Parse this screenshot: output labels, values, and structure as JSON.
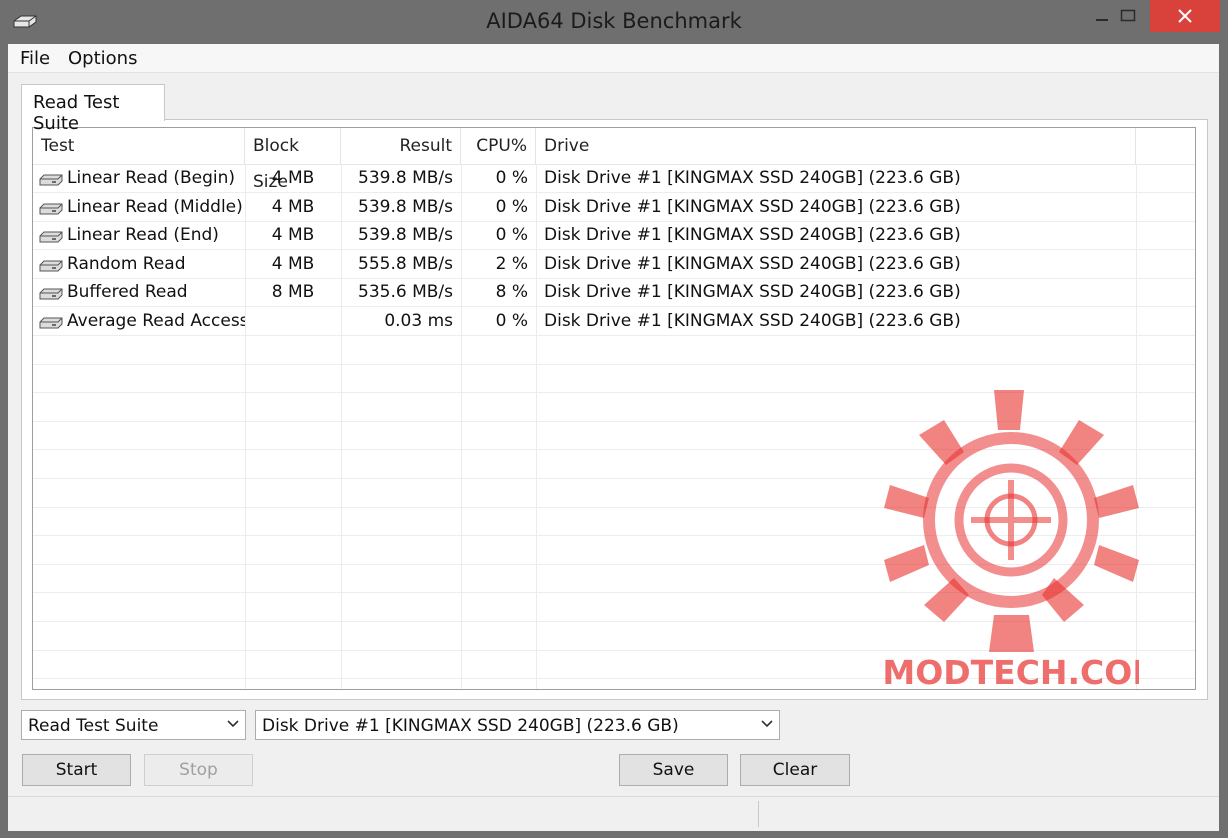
{
  "window": {
    "title": "AIDA64 Disk Benchmark",
    "close_color": "#d9413b"
  },
  "menu": [
    "File",
    "Options"
  ],
  "tab": {
    "label": "Read Test Suite"
  },
  "table": {
    "columns": [
      "Test",
      "Block Size",
      "Result",
      "CPU%",
      "Drive"
    ],
    "rows": [
      {
        "test": "Linear Read (Begin)",
        "block": "4 MB",
        "result": "539.8 MB/s",
        "cpu": "0 %",
        "drive": "Disk Drive #1  [KINGMAX SSD 240GB]  (223.6 GB)"
      },
      {
        "test": "Linear Read (Middle)",
        "block": "4 MB",
        "result": "539.8 MB/s",
        "cpu": "0 %",
        "drive": "Disk Drive #1  [KINGMAX SSD 240GB]  (223.6 GB)"
      },
      {
        "test": "Linear Read (End)",
        "block": "4 MB",
        "result": "539.8 MB/s",
        "cpu": "0 %",
        "drive": "Disk Drive #1  [KINGMAX SSD 240GB]  (223.6 GB)"
      },
      {
        "test": "Random Read",
        "block": "4 MB",
        "result": "555.8 MB/s",
        "cpu": "2 %",
        "drive": "Disk Drive #1  [KINGMAX SSD 240GB]  (223.6 GB)"
      },
      {
        "test": "Buffered Read",
        "block": "8 MB",
        "result": "535.6 MB/s",
        "cpu": "8 %",
        "drive": "Disk Drive #1  [KINGMAX SSD 240GB]  (223.6 GB)"
      },
      {
        "test": "Average Read Access",
        "block": "",
        "result": "0.03 ms",
        "cpu": "0 %",
        "drive": "Disk Drive #1  [KINGMAX SSD 240GB]  (223.6 GB)"
      }
    ]
  },
  "watermark": {
    "text": "VMODTECH.COM",
    "color": "#e8322f"
  },
  "controls": {
    "suite_select": "Read Test Suite",
    "drive_select": "Disk Drive #1  [KINGMAX SSD 240GB]  (223.6 GB)",
    "start": "Start",
    "stop": "Stop",
    "save": "Save",
    "clear": "Clear"
  },
  "icons": {
    "app": "disk-drive-icon",
    "row": "hard-disk-icon"
  }
}
